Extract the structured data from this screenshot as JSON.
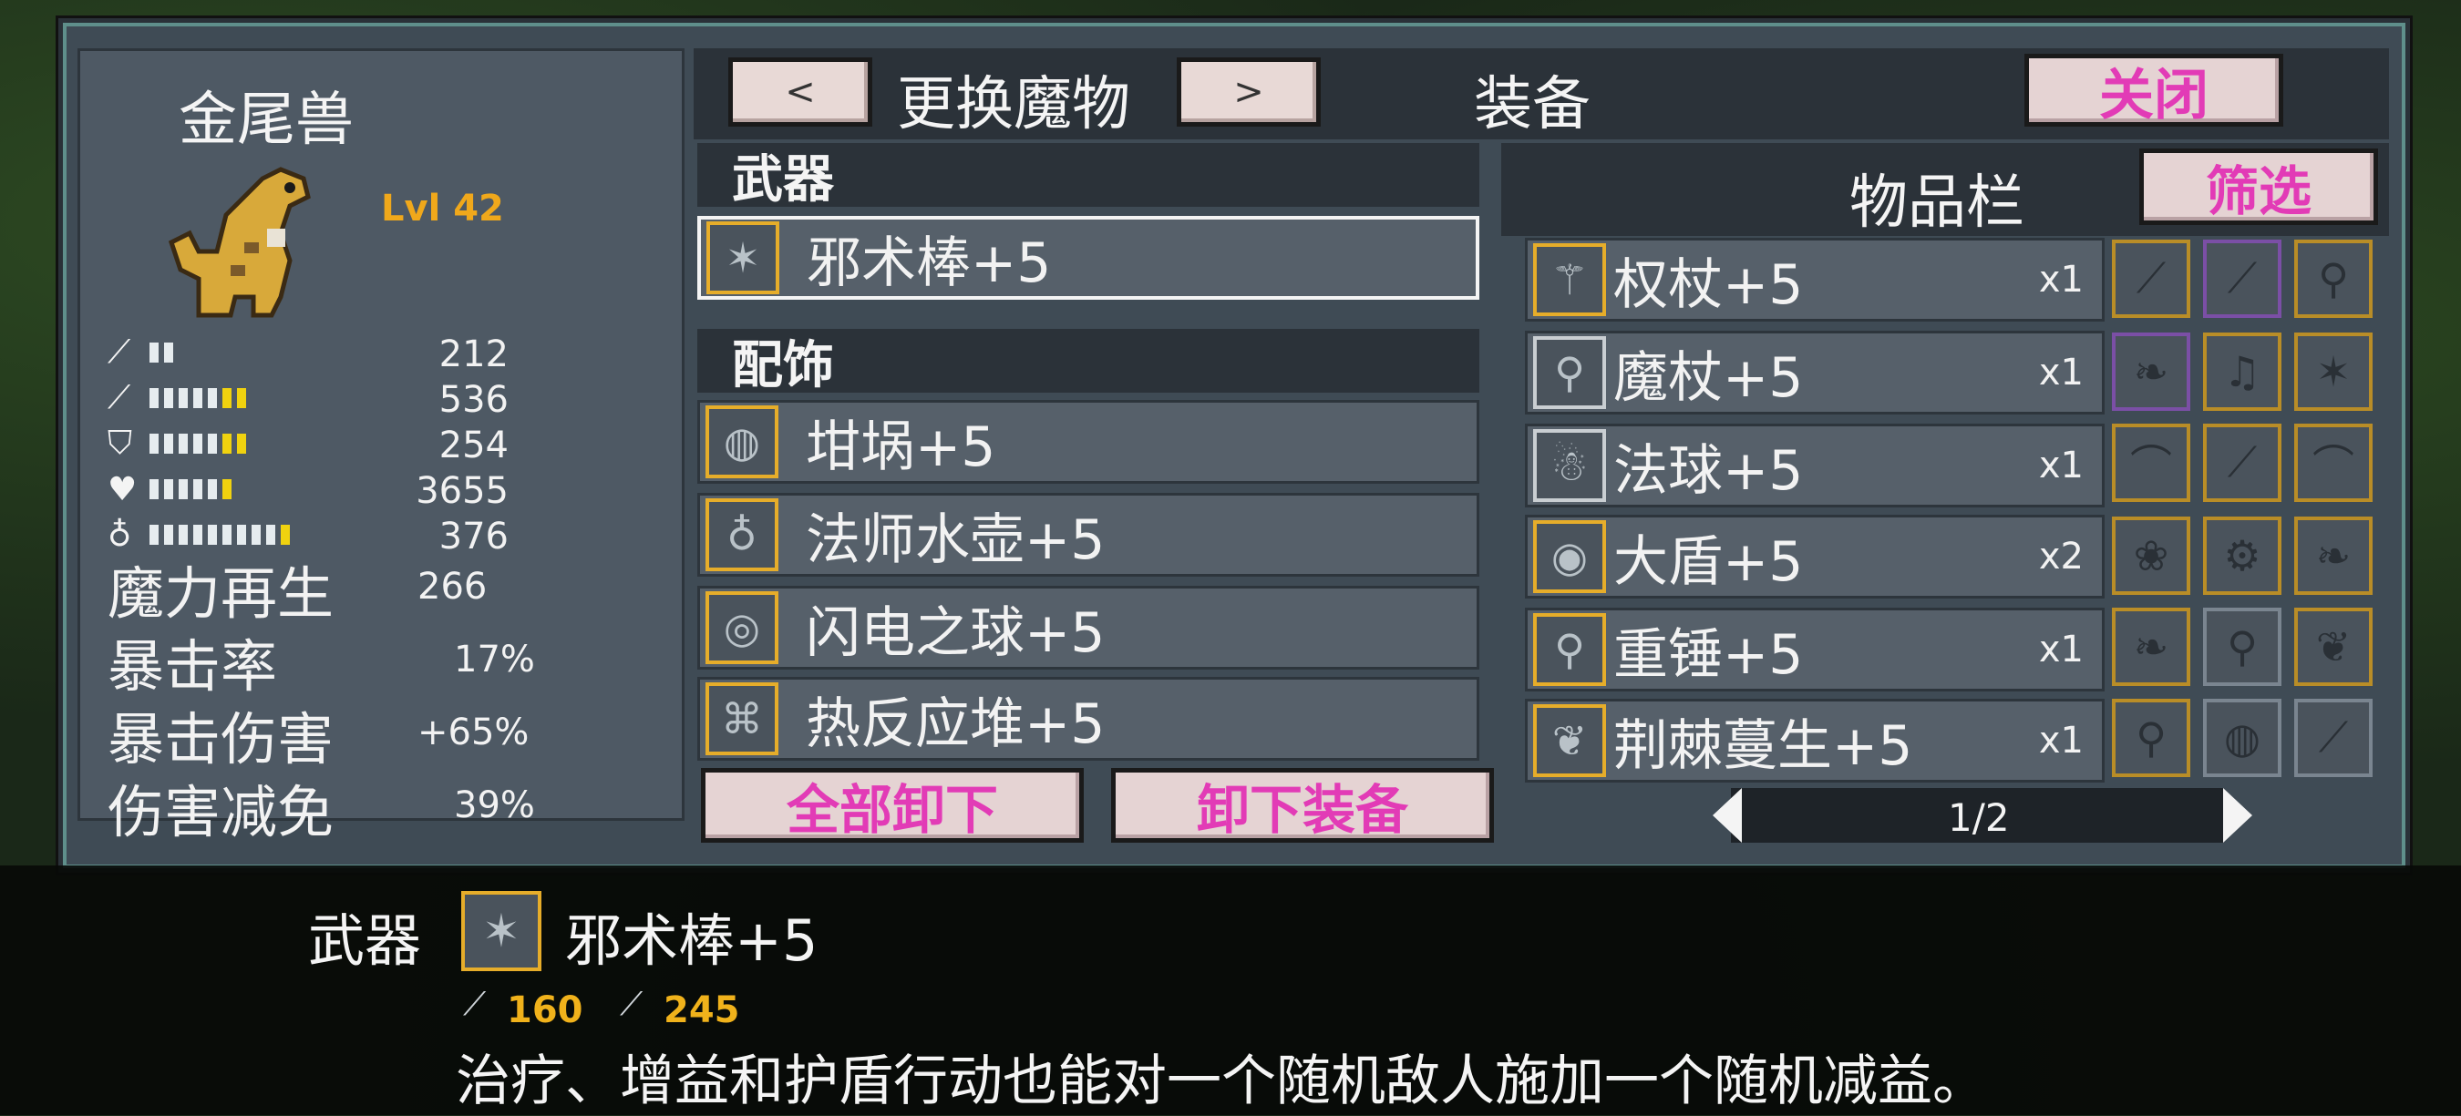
{
  "monster": {
    "name": "金尾兽",
    "level": "Lvl 42",
    "stats": [
      {
        "icon": "sword-icon",
        "value": "212",
        "white_bars": 2,
        "yellow_bars": 0
      },
      {
        "icon": "wand-icon",
        "value": "536",
        "white_bars": 5,
        "yellow_bars": 2
      },
      {
        "icon": "shield-icon",
        "value": "254",
        "white_bars": 5,
        "yellow_bars": 2
      },
      {
        "icon": "heart-icon",
        "value": "3655",
        "white_bars": 5,
        "yellow_bars": 1
      },
      {
        "icon": "potion-icon",
        "value": "376",
        "white_bars": 9,
        "yellow_bars": 1
      }
    ],
    "extra": [
      {
        "label": "魔力再生",
        "value": "266"
      },
      {
        "label": "暴击率",
        "value": "17%"
      },
      {
        "label": "暴击伤害",
        "value": "+65%"
      },
      {
        "label": "伤害减免",
        "value": "39%"
      }
    ]
  },
  "top": {
    "prev": "<",
    "change_monster": "更换魔物",
    "next": ">",
    "equip_title": "装备",
    "close": "关闭"
  },
  "weapon": {
    "header": "武器",
    "item": {
      "icon": "staff-icon",
      "name": "邪术棒+5"
    }
  },
  "accessory": {
    "header": "配饰",
    "items": [
      {
        "icon": "pot-icon",
        "name": "坩埚+5"
      },
      {
        "icon": "flask-icon",
        "name": "法师水壶+5"
      },
      {
        "icon": "orb-icon",
        "name": "闪电之球+5"
      },
      {
        "icon": "reactor-icon",
        "name": "热反应堆+5"
      }
    ]
  },
  "buttons": {
    "unequip_all": "全部卸下",
    "unequip": "卸下装备"
  },
  "inventory": {
    "title": "物品栏",
    "filter": "筛选",
    "items": [
      {
        "icon": "scepter-icon",
        "name": "权杖+5",
        "qty": "x1"
      },
      {
        "icon": "magic-wand-icon",
        "name": "魔杖+5",
        "qty": "x1"
      },
      {
        "icon": "crystal-ball-icon",
        "name": "法球+5",
        "qty": "x1"
      },
      {
        "icon": "big-shield-icon",
        "name": "大盾+5",
        "qty": "x2"
      },
      {
        "icon": "hammer-icon",
        "name": "重锤+5",
        "qty": "x1"
      },
      {
        "icon": "thorn-icon",
        "name": "荆棘蔓生+5",
        "qty": "x1"
      }
    ],
    "page": "1/2"
  },
  "detail": {
    "slot": "武器",
    "name": "邪术棒+5",
    "atk": "160",
    "mag": "245",
    "description": "治疗、增益和护盾行动也能对一个随机敌人施加一个随机减益。"
  },
  "colors": {
    "accent": "#e6ad2a",
    "pink": "#e23bb6",
    "panel": "#3f4b55"
  }
}
